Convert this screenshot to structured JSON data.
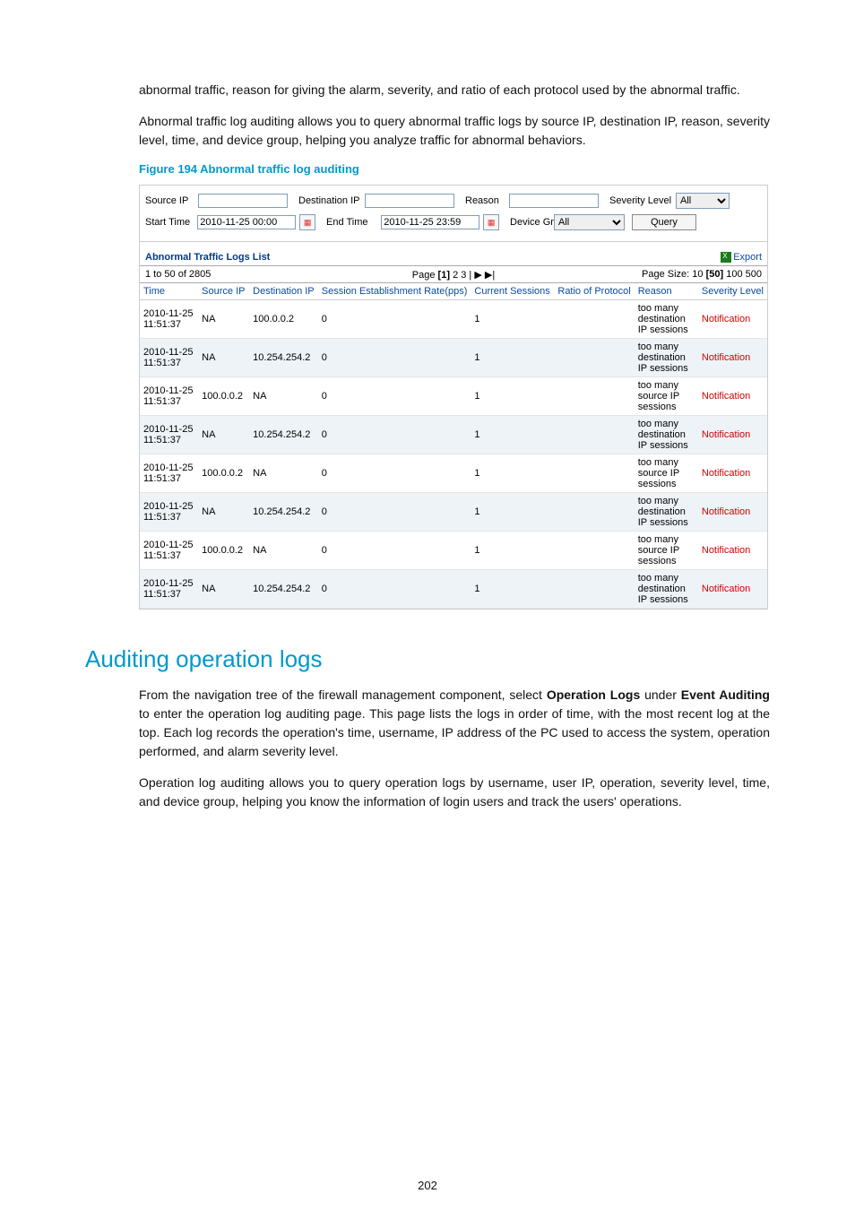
{
  "intro_p1": "abnormal traffic, reason for giving the alarm, severity, and ratio of each protocol used by the abnormal traffic.",
  "intro_p2": "Abnormal traffic log auditing allows you to query abnormal traffic logs by source IP, destination IP, reason, severity level, time, and device group, helping you analyze traffic for abnormal behaviors.",
  "figure_caption": "Figure 194 Abnormal traffic log auditing",
  "filter": {
    "source_ip_label": "Source IP",
    "source_ip_value": "",
    "dest_ip_label": "Destination IP",
    "dest_ip_value": "",
    "reason_label": "Reason",
    "reason_value": "",
    "severity_label": "Severity Level",
    "severity_value": "All",
    "start_time_label": "Start Time",
    "start_time_value": "2010-11-25 00:00",
    "end_time_label": "End Time",
    "end_time_value": "2010-11-25 23:59",
    "device_group_label": "Device Group",
    "device_group_value": "All",
    "query_button": "Query"
  },
  "list_title": "Abnormal Traffic Logs List",
  "export_label": "Export",
  "pager": {
    "range": "1 to 50 of 2805",
    "page_label": "Page",
    "p1": "[1]",
    "p2": "2",
    "p3": "3",
    "next": "▶",
    "last": "▶|",
    "size_label": "Page Size:",
    "s10": "10",
    "s50": "[50]",
    "s100": "100",
    "s500": "500"
  },
  "columns": {
    "time": "Time",
    "source_ip": "Source IP",
    "dest_ip": "Destination IP",
    "rate": "Session Establishment Rate(pps)",
    "sessions": "Current Sessions",
    "ratio": "Ratio of Protocol",
    "reason": "Reason",
    "severity": "Severity Level"
  },
  "rows": [
    {
      "time": "2010-11-25 11:51:37",
      "src": "NA",
      "dst": "100.0.0.2",
      "rate": "0",
      "sess": "1",
      "ratio": "",
      "reason": "too many destination IP sessions",
      "sev": "Notification"
    },
    {
      "time": "2010-11-25 11:51:37",
      "src": "NA",
      "dst": "10.254.254.2",
      "rate": "0",
      "sess": "1",
      "ratio": "",
      "reason": "too many destination IP sessions",
      "sev": "Notification"
    },
    {
      "time": "2010-11-25 11:51:37",
      "src": "100.0.0.2",
      "dst": "NA",
      "rate": "0",
      "sess": "1",
      "ratio": "",
      "reason": "too many source IP sessions",
      "sev": "Notification"
    },
    {
      "time": "2010-11-25 11:51:37",
      "src": "NA",
      "dst": "10.254.254.2",
      "rate": "0",
      "sess": "1",
      "ratio": "",
      "reason": "too many destination IP sessions",
      "sev": "Notification"
    },
    {
      "time": "2010-11-25 11:51:37",
      "src": "100.0.0.2",
      "dst": "NA",
      "rate": "0",
      "sess": "1",
      "ratio": "",
      "reason": "too many source IP sessions",
      "sev": "Notification"
    },
    {
      "time": "2010-11-25 11:51:37",
      "src": "NA",
      "dst": "10.254.254.2",
      "rate": "0",
      "sess": "1",
      "ratio": "",
      "reason": "too many destination IP sessions",
      "sev": "Notification"
    },
    {
      "time": "2010-11-25 11:51:37",
      "src": "100.0.0.2",
      "dst": "NA",
      "rate": "0",
      "sess": "1",
      "ratio": "",
      "reason": "too many source IP sessions",
      "sev": "Notification"
    },
    {
      "time": "2010-11-25 11:51:37",
      "src": "NA",
      "dst": "10.254.254.2",
      "rate": "0",
      "sess": "1",
      "ratio": "",
      "reason": "too many destination IP sessions",
      "sev": "Notification"
    }
  ],
  "section_heading": "Auditing operation logs",
  "section_p1_a": "From the navigation tree of the firewall management component, select ",
  "section_p1_b": "Operation Logs",
  "section_p1_c": " under ",
  "section_p1_d": "Event Auditing",
  "section_p1_e": " to enter the operation log auditing page. This page lists the logs in order of time, with the most recent log at the top. Each log records the operation's time, username, IP address of the PC used to access the system, operation performed, and alarm severity level.",
  "section_p2": "Operation log auditing allows you to query operation logs by username, user IP, operation, severity level, time, and device group, helping you know the information of login users and track the users' operations.",
  "page_number": "202"
}
